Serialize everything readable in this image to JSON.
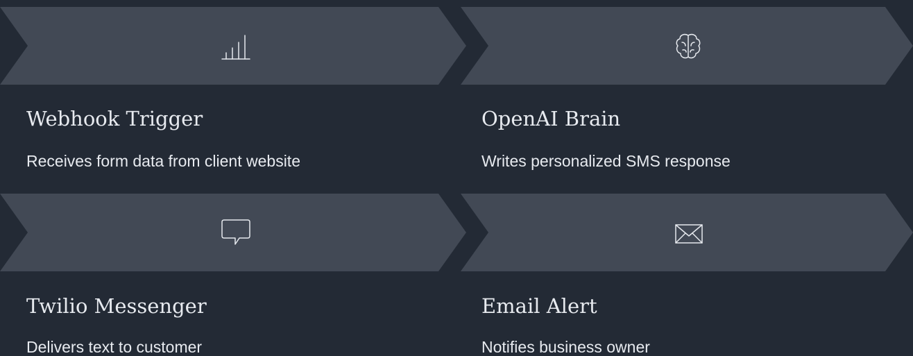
{
  "steps": [
    {
      "icon": "bar-chart-icon",
      "title": "Webhook Trigger",
      "description": "Receives form data from client website"
    },
    {
      "icon": "brain-icon",
      "title": "OpenAI Brain",
      "description": "Writes personalized SMS response"
    },
    {
      "icon": "chat-bubble-icon",
      "title": "Twilio Messenger",
      "description": "Delivers text to customer"
    },
    {
      "icon": "envelope-icon",
      "title": "Email Alert",
      "description": "Notifies business owner"
    }
  ],
  "colors": {
    "background": "#232a35",
    "chevron": "#424955",
    "text": "#e7eaef",
    "icon": "#e6e9ee"
  }
}
